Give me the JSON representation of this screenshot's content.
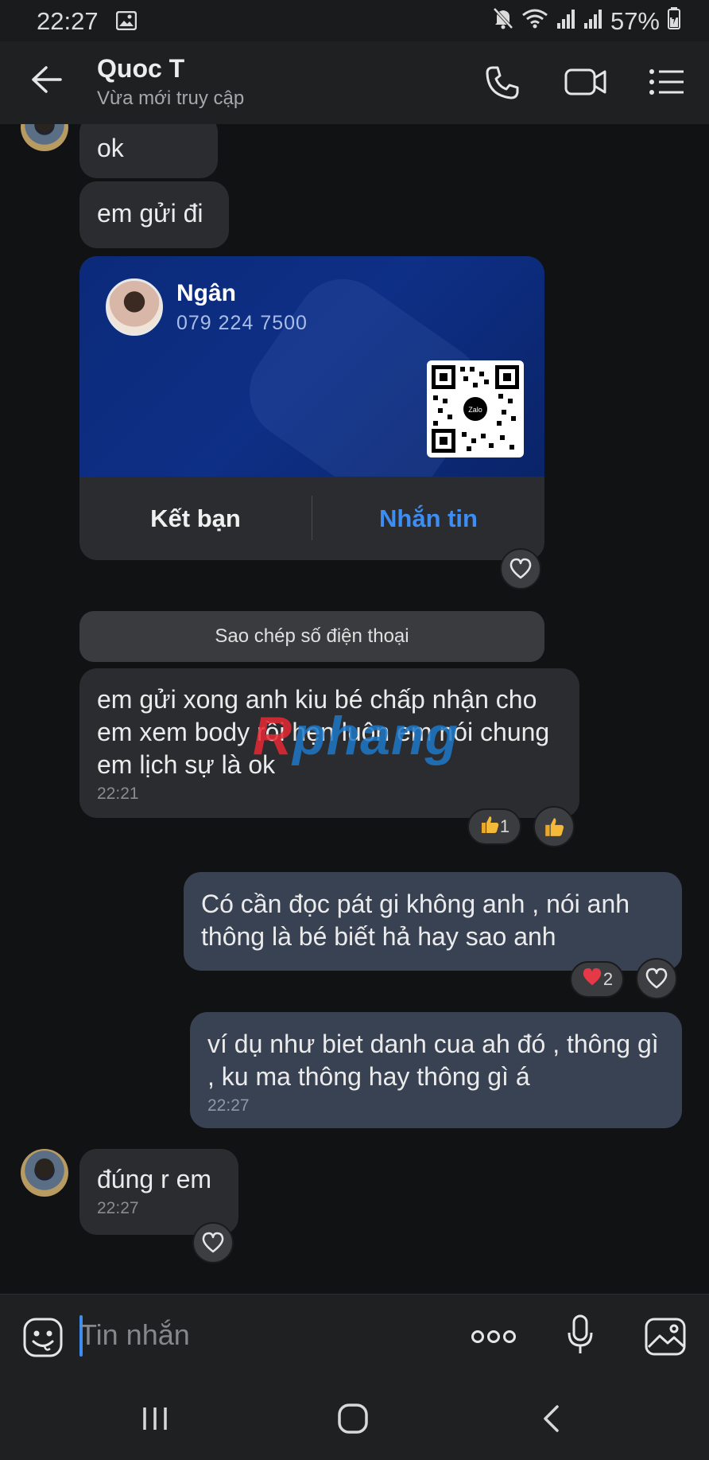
{
  "status_bar": {
    "time": "22:27",
    "battery": "57%"
  },
  "header": {
    "contact_name": "Quoc T",
    "presence": "Vừa mới truy cập"
  },
  "messages": {
    "m1": {
      "text": "ok"
    },
    "m2": {
      "text": "em gửi đi"
    },
    "card": {
      "name": "Ngân",
      "phone": "079 224 7500",
      "qr_label": "Zalo",
      "add_friend": "Kết bạn",
      "send_message": "Nhắn tin"
    },
    "copy_phone": "Sao chép số điện thoại",
    "m3": {
      "text": "em gửi xong anh kiu bé chấp nhận cho em xem body rồi hẹn luôn em nói chung em lịch sự là ok",
      "time": "22:21",
      "reaction_count": "1"
    },
    "m4": {
      "text": "Có cần đọc pát gi không anh , nói anh thông là bé biết hả hay sao anh",
      "reaction_count": "2"
    },
    "m5": {
      "text": "ví dụ như biet danh cua ah đó , thông gì , ku ma thông hay thông gì á",
      "time": "22:27"
    },
    "m6": {
      "text": "đúng r em",
      "time": "22:27"
    }
  },
  "watermark": {
    "part1": "R",
    "part2": "phang"
  },
  "composer": {
    "placeholder": "Tin nhắn"
  },
  "colors": {
    "accent": "#3d8df3",
    "my_bubble": "#384253",
    "their_bubble": "#2b2c2f",
    "card_blue": "#0e2f86"
  }
}
